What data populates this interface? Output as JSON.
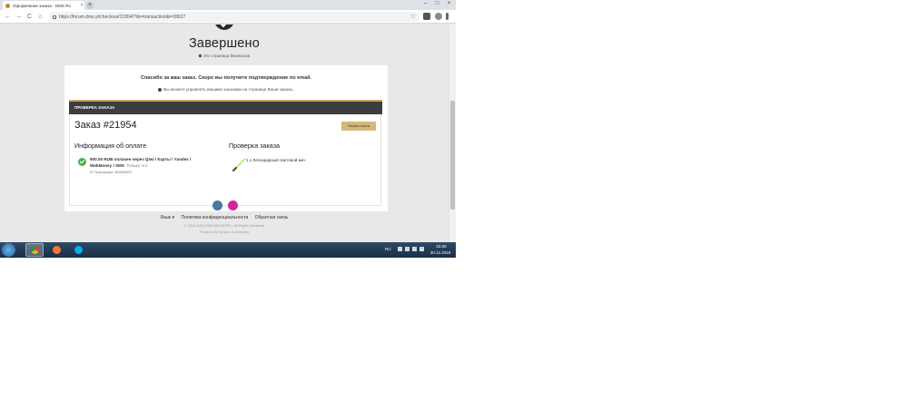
{
  "browser": {
    "tab_title": "Оформление заказа - DMS Rö",
    "tab_close": "×",
    "new_tab": "+",
    "url": "https://forum.dms.yt/checkout/21954/?do=transaction&t=28627",
    "window_minimize": "–",
    "window_maximize": "□",
    "window_close": "×",
    "back": "←",
    "forward": "→",
    "reload": "C",
    "home": "⌂",
    "bookmark_star": "☆"
  },
  "page": {
    "heading": "Завершено",
    "secure_note": "Это страница безопасна",
    "thanks": "Спасибо за ваш заказ. Скоро вы получите подтверждение по email.",
    "manage_note": "Вы можете управлять вашими заказами на странице Ваши заказы.",
    "review_bar": "ПРОВЕРКА ЗАКАЗА",
    "order_number": "Заказ #21954",
    "print_button": "Печать счета",
    "payment_title": "Информация об оплате",
    "payment_line1": "900.00 RUB оплачен через Qiwi / Карты / Yandex /",
    "payment_line2": "WebMoney / SMS",
    "payment_when": "Только что",
    "transaction_id": "ID Транзакции: 883583801",
    "review_title": "Проверка заказа",
    "item": "1 x Легендарный световой меч",
    "footer": {
      "language": "Язык ▾",
      "privacy": "Политика конфиденциальности",
      "feedback": "Обратная связь",
      "copyright": "© 2016-2018 DMS NETWORK - All Rights Reserved",
      "powered": "Powered by Invision Community"
    }
  },
  "taskbar": {
    "language": "RU",
    "time": "23:26",
    "date": "30.12.2018"
  },
  "colors": {
    "accent_gold": "#c9a961",
    "print_button": "#d3b879",
    "success_green": "#4caf50",
    "dark_bar": "#3d3d3d",
    "vk_blue": "#4a76a8",
    "instagram": "#d6249f"
  }
}
